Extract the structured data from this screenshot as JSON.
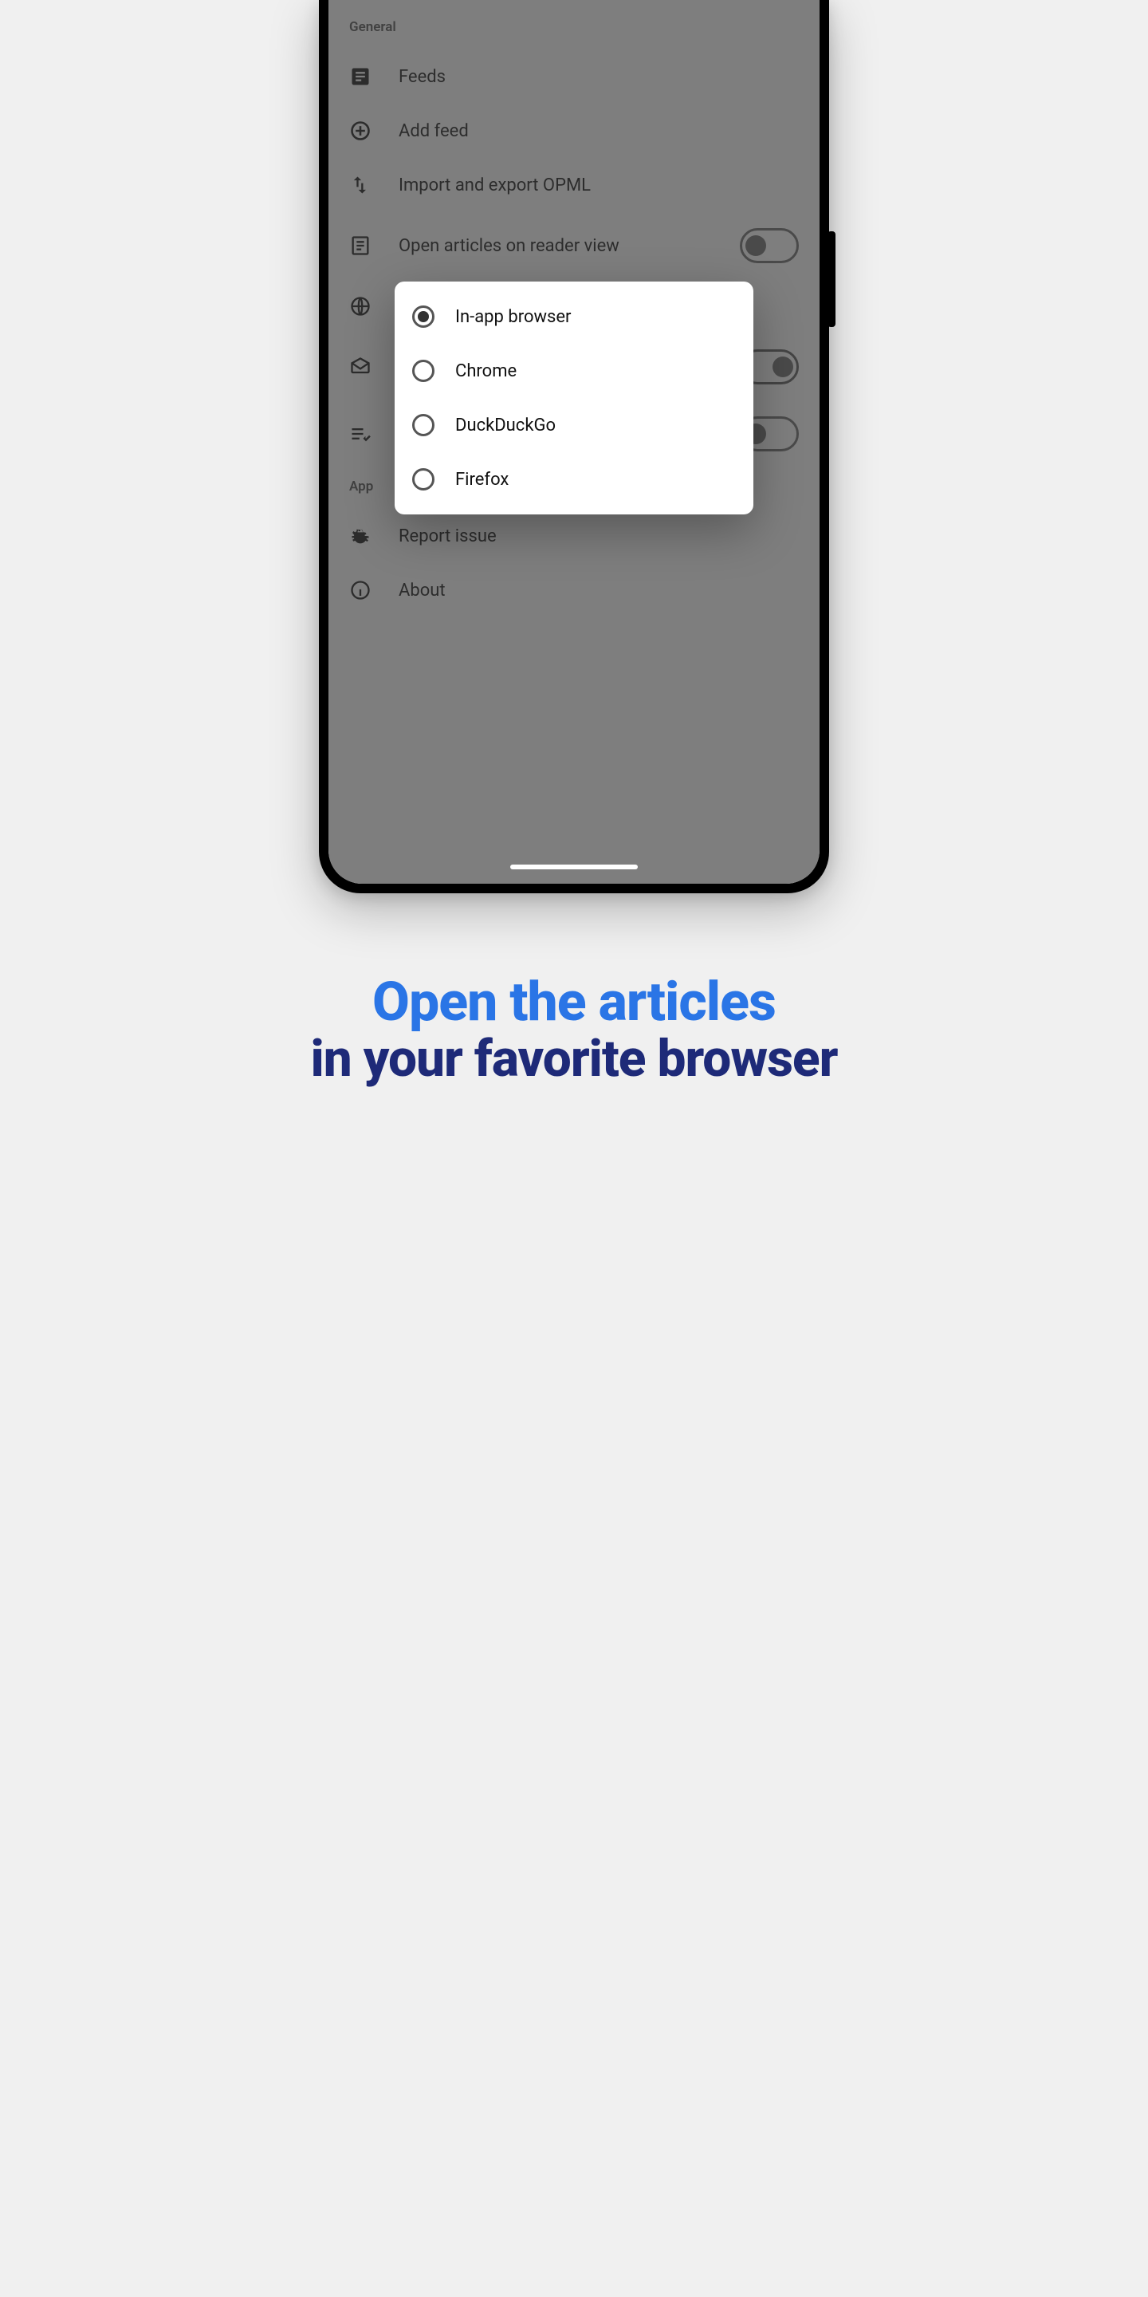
{
  "sections": {
    "general": {
      "title": "General",
      "items": {
        "feeds": "Feeds",
        "add_feed": "Add feed",
        "import_export": "Import and export OPML",
        "reader_view": "Open articles on reader view",
        "browser_row": "",
        "mail_row": "",
        "checklist_row": ""
      }
    },
    "app": {
      "title": "App",
      "items": {
        "report_issue": "Report issue",
        "about": "About"
      }
    }
  },
  "dialog": {
    "options": [
      {
        "label": "In-app browser",
        "selected": true
      },
      {
        "label": "Chrome",
        "selected": false
      },
      {
        "label": "DuckDuckGo",
        "selected": false
      },
      {
        "label": "Firefox",
        "selected": false
      }
    ]
  },
  "caption": {
    "line1": "Open the articles",
    "line2": "in your favorite browser"
  }
}
